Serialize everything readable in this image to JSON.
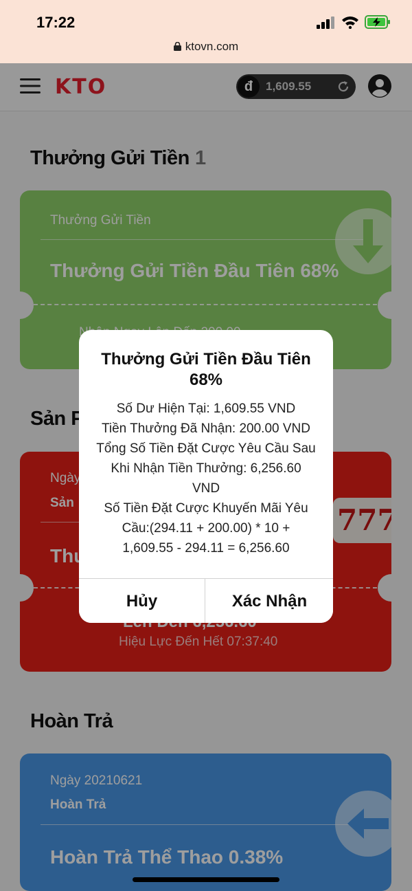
{
  "status_bar": {
    "time": "17:22",
    "url": "ktovn.com"
  },
  "header": {
    "logo": "KTO",
    "currency_symbol": "đ",
    "balance": "1,609.55"
  },
  "sections": {
    "deposit_bonus": {
      "title": "Thưởng Gửi Tiền",
      "count": "1"
    },
    "products": {
      "title_visible": "Sản P"
    },
    "rebate": {
      "title": "Hoàn Trả"
    }
  },
  "cards": {
    "deposit": {
      "category": "Thưởng Gửi Tiền",
      "title": "Thưởng Gửi Tiền Đầu Tiên 68%",
      "footer_partial": "Nhận Ngay Lên Đến 200.00"
    },
    "product": {
      "date_partial": "Ngày",
      "type_partial": "Sản",
      "title_partial": "Thư",
      "footer_partial": "Lên Đến 6,256.60",
      "validity": "Hiệu Lực Đến Hết 07:37:40",
      "badge": "777"
    },
    "rebate": {
      "date": "Ngày 20210621",
      "type": "Hoàn Trả",
      "title": "Hoàn Trả Thể Thao 0.38%"
    }
  },
  "dialog": {
    "title": "Thưởng Gửi Tiền Đầu Tiên 68%",
    "lines": [
      "Số Dư Hiện Tại: 1,609.55 VND",
      "Tiền Thưởng Đã Nhận: 200.00 VND",
      "Tổng Số Tiền Đặt Cược Yêu Cầu Sau",
      "Khi Nhận Tiền Thưởng: 6,256.60",
      "VND",
      "Số Tiền Đặt Cược Khuyến Mãi Yêu",
      "Cầu:(294.11 + 200.00) * 10 +",
      "1,609.55 - 294.11 = 6,256.60"
    ],
    "cancel_label": "Hủy",
    "confirm_label": "Xác Nhận"
  },
  "colors": {
    "brand_red": "#e4202e",
    "card_green": "#8fd16a",
    "card_red": "#e52018",
    "card_blue": "#4a97e6"
  },
  "icons": [
    "lock-icon",
    "signal-icon",
    "wifi-icon",
    "battery-charging-icon",
    "menu-icon",
    "refresh-icon",
    "user-avatar-icon",
    "arrow-down-icon",
    "arrow-left-icon"
  ]
}
